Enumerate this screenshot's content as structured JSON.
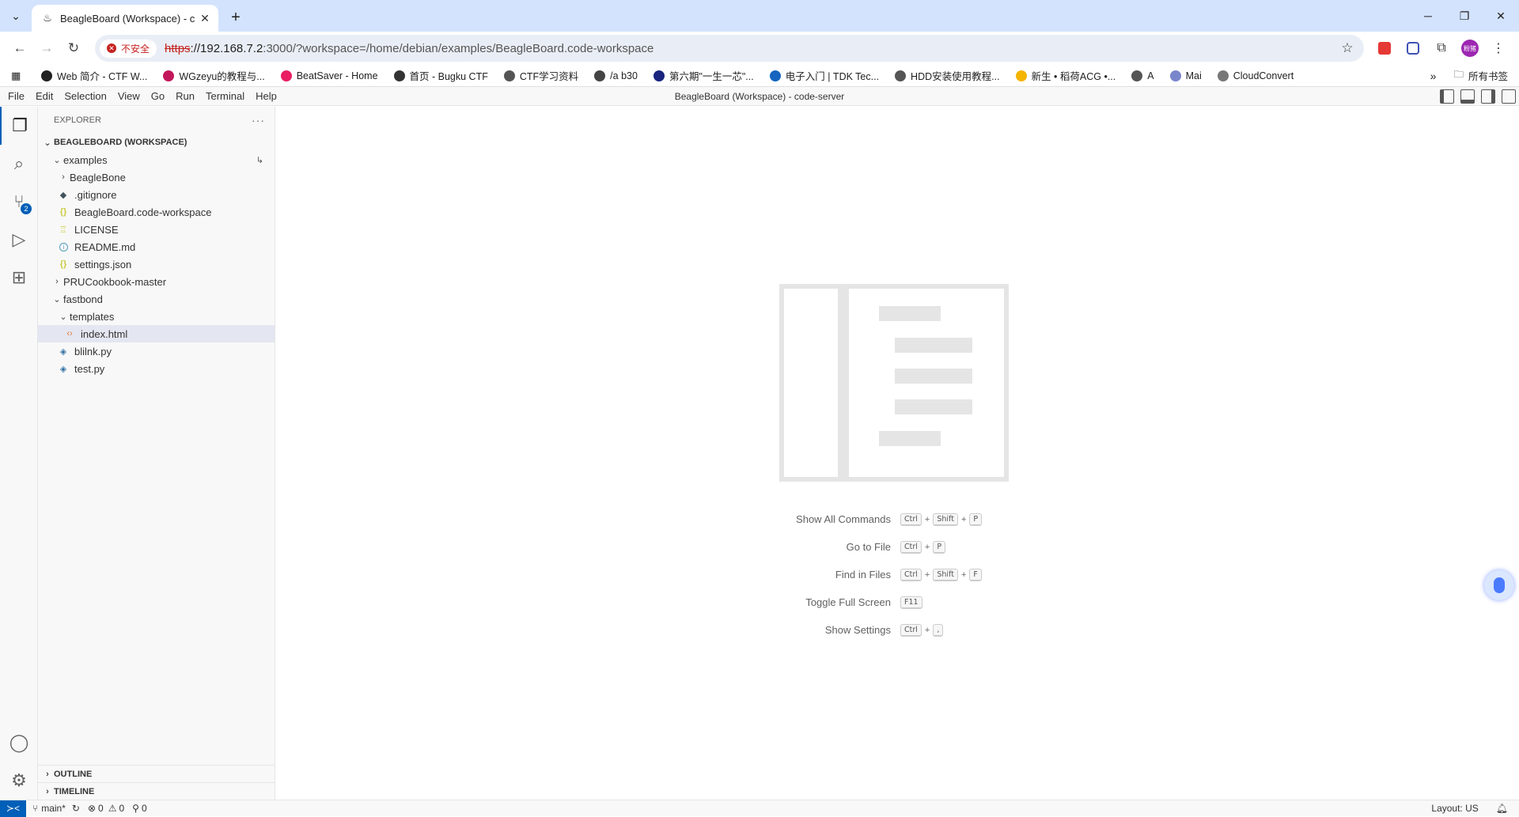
{
  "browser": {
    "tab_title": "BeagleBoard (Workspace) - c",
    "url_proto": "https",
    "url_host": "://192.168.7.2",
    "url_path": ":3000/?workspace=/home/debian/examples/BeagleBoard.code-workspace",
    "insecure_label": "不安全",
    "avatar_text": "粉猪"
  },
  "bookmarks": [
    {
      "label": "Web 简介 - CTF W...",
      "color": "#222222"
    },
    {
      "label": "WGzeyu的教程与...",
      "color": "#c2185b"
    },
    {
      "label": "BeatSaver - Home",
      "color": "#e91e63"
    },
    {
      "label": "首页 - Bugku CTF",
      "color": "#333333"
    },
    {
      "label": "CTF学习资料",
      "color": "#555555"
    },
    {
      "label": "/a b30",
      "color": "#444444"
    },
    {
      "label": "第六期\"一生一芯\"...",
      "color": "#1a237e"
    },
    {
      "label": "电子入门 | TDK Tec...",
      "color": "#1565c0"
    },
    {
      "label": "HDD安装使用教程...",
      "color": "#555555"
    },
    {
      "label": "新生 • 稻荷ACG •...",
      "color": "#f4b400"
    },
    {
      "label": "A",
      "color": "#555555"
    },
    {
      "label": "Mai",
      "color": "#7986cb"
    },
    {
      "label": "CloudConvert",
      "color": "#777777"
    }
  ],
  "bookmarks_all": "所有书签",
  "menu": [
    "File",
    "Edit",
    "Selection",
    "View",
    "Go",
    "Run",
    "Terminal",
    "Help"
  ],
  "window_title": "BeagleBoard (Workspace) - code-server",
  "explorer": {
    "header": "EXPLORER",
    "workspace": "BEAGLEBOARD (WORKSPACE)",
    "items": {
      "examples": "examples",
      "beaglebone": "BeagleBone",
      "gitignore": ".gitignore",
      "workspace_file": "BeagleBoard.code-workspace",
      "license": "LICENSE",
      "readme": "README.md",
      "settings": "settings.json",
      "pru": "PRUCookbook-master",
      "fastbond": "fastbond",
      "templates": "templates",
      "index": "index.html",
      "blilnk": "blilnk.py",
      "test": "test.py"
    },
    "outline": "OUTLINE",
    "timeline": "TIMELINE"
  },
  "scm_badge": "2",
  "shortcuts": [
    {
      "label": "Show All Commands",
      "keys": [
        "Ctrl",
        "Shift",
        "P"
      ]
    },
    {
      "label": "Go to File",
      "keys": [
        "Ctrl",
        "P"
      ]
    },
    {
      "label": "Find in Files",
      "keys": [
        "Ctrl",
        "Shift",
        "F"
      ]
    },
    {
      "label": "Toggle Full Screen",
      "keys": [
        "F11"
      ]
    },
    {
      "label": "Show Settings",
      "keys": [
        "Ctrl",
        ","
      ]
    }
  ],
  "status": {
    "branch": "main*",
    "errors": "0",
    "warnings": "0",
    "ports": "0",
    "layout": "Layout: US"
  }
}
